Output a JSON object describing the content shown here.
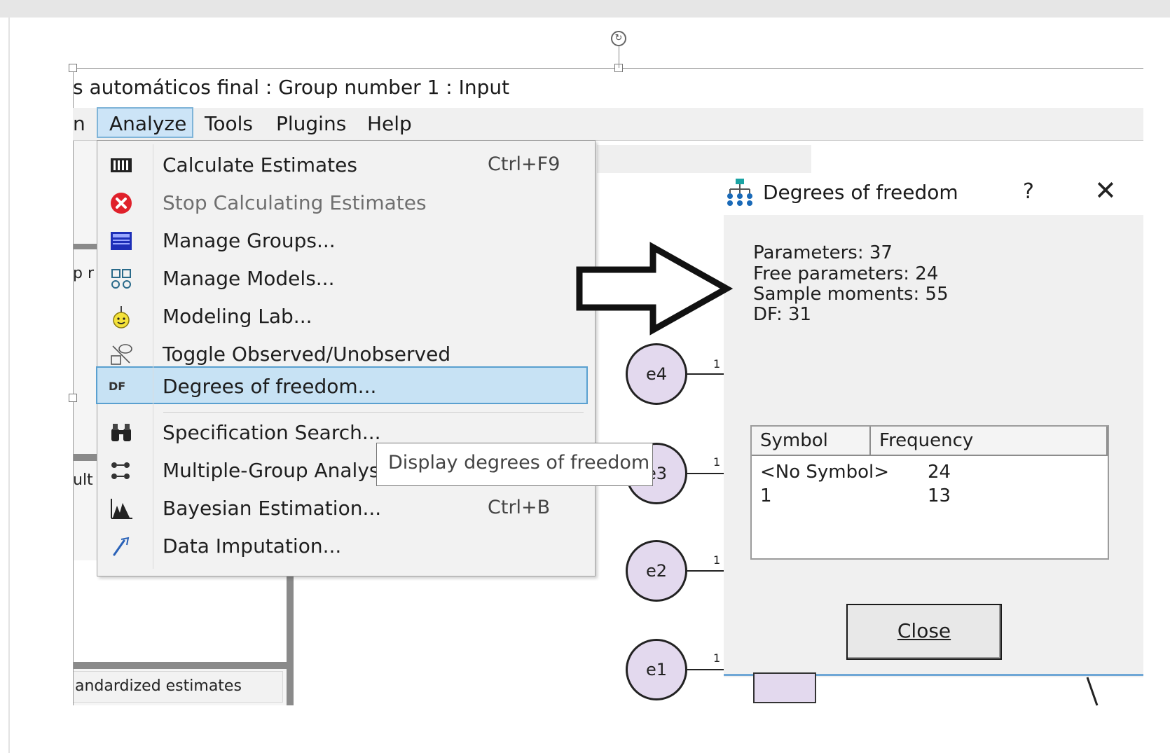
{
  "window": {
    "title": "s automáticos final : Group number 1 : Input"
  },
  "menubar": {
    "fragment": "n",
    "items": [
      "Analyze",
      "Tools",
      "Plugins",
      "Help"
    ]
  },
  "analyze_menu": {
    "items": [
      {
        "label": "Calculate Estimates",
        "shortcut": "Ctrl+F9",
        "icon": "calculate-estimates-icon"
      },
      {
        "label": "Stop Calculating Estimates",
        "shortcut": "",
        "icon": "stop-icon",
        "disabled": true
      },
      {
        "label": "Manage Groups...",
        "shortcut": "",
        "icon": "manage-groups-icon"
      },
      {
        "label": "Manage Models...",
        "shortcut": "",
        "icon": "manage-models-icon"
      },
      {
        "label": "Modeling Lab...",
        "shortcut": "",
        "icon": "modeling-lab-icon"
      },
      {
        "label": "Toggle Observed/Unobserved",
        "shortcut": "",
        "icon": "toggle-observed-icon"
      },
      {
        "label": "Degrees of freedom...",
        "shortcut": "",
        "icon": "df-icon",
        "highlighted": true,
        "icon_text": "DF"
      },
      {
        "label": "Specification Search...",
        "shortcut": "",
        "icon": "binoculars-icon"
      },
      {
        "label": "Multiple-Group Analysi",
        "shortcut": "",
        "icon": "multiple-group-icon"
      },
      {
        "label": "Bayesian Estimation...",
        "shortcut": "Ctrl+B",
        "icon": "bayesian-icon"
      },
      {
        "label": "Data Imputation...",
        "shortcut": "",
        "icon": "data-imputation-icon"
      }
    ]
  },
  "tooltip": {
    "text": "Display degrees of freedom"
  },
  "left_panel": {
    "fragment_p": "p r",
    "fragment_ult": "ult",
    "standardized": "andardized estimates"
  },
  "diagram": {
    "nodes": [
      "e4",
      "e3",
      "e2",
      "e1"
    ],
    "path_label": "1"
  },
  "dialog": {
    "title": "Degrees of freedom",
    "help": "?",
    "stats": [
      "Parameters:  37",
      "Free parameters:  24",
      "Sample moments:  55",
      "DF:  31"
    ],
    "table": {
      "headers": [
        "Symbol",
        "Frequency"
      ],
      "rows": [
        [
          "<No Symbol>",
          "24"
        ],
        [
          "1",
          "13"
        ]
      ]
    },
    "close_label": "Close"
  },
  "colors": {
    "highlight": "#c7e2f4",
    "node_fill": "#e3d9ee",
    "accent_line": "#6fa7d6"
  }
}
